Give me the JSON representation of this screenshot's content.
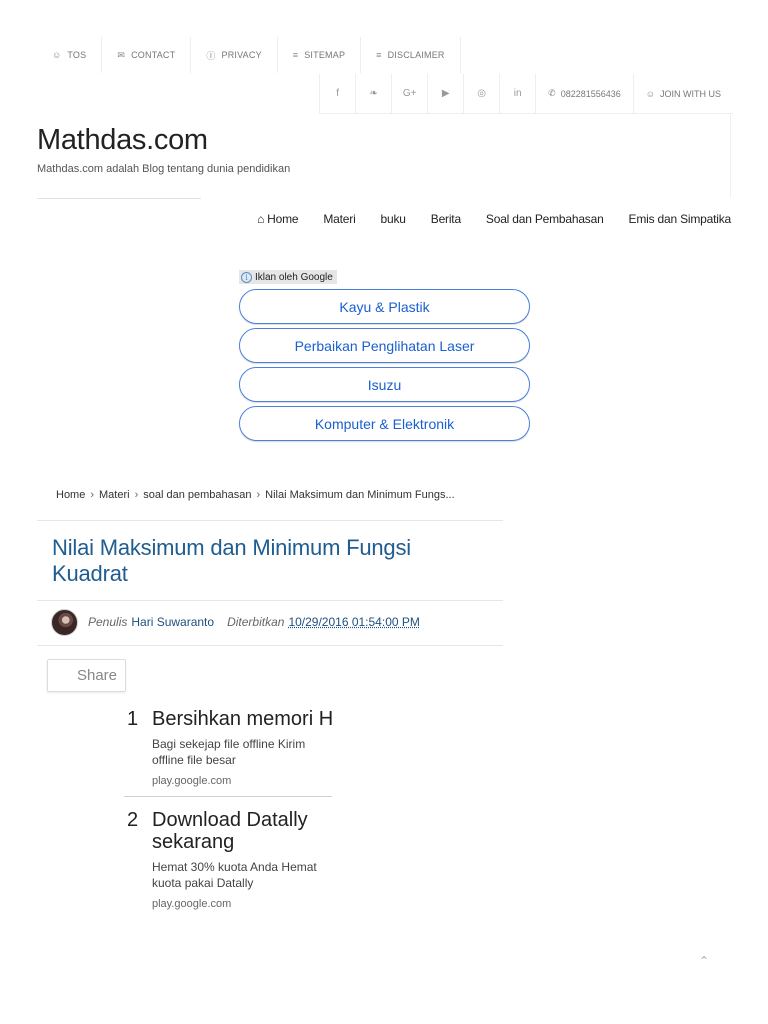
{
  "top_menu": [
    {
      "icon": "user-icon",
      "glyph": "☺",
      "label": "TOS"
    },
    {
      "icon": "envelope-icon",
      "glyph": "✉",
      "label": "CONTACT"
    },
    {
      "icon": "info-icon",
      "glyph": "ⓘ",
      "label": "PRIVACY"
    },
    {
      "icon": "list-icon",
      "glyph": "≡",
      "label": "SITEMAP"
    },
    {
      "icon": "list-icon",
      "glyph": "≡",
      "label": "DISCLAIMER"
    }
  ],
  "social": {
    "icons": [
      {
        "name": "facebook-icon",
        "glyph": "f"
      },
      {
        "name": "twitter-icon",
        "glyph": "❧"
      },
      {
        "name": "google-plus-icon",
        "glyph": "G+"
      },
      {
        "name": "youtube-icon",
        "glyph": "▶"
      },
      {
        "name": "instagram-icon",
        "glyph": "◎"
      },
      {
        "name": "linkedin-icon",
        "glyph": "in"
      }
    ],
    "phone": "082281556436",
    "join": "JOIN WITH US"
  },
  "header": {
    "site_title": "Mathdas.com",
    "site_description": "Mathdas.com adalah Blog tentang dunia pendidikan"
  },
  "nav": {
    "items": [
      "Home",
      "Materi",
      "buku",
      "Berita",
      "Soal dan Pembahasan",
      "Emis dan Simpatika"
    ]
  },
  "ad_block": {
    "label": "Iklan oleh Google",
    "links": [
      "Kayu & Plastik",
      "Perbaikan Penglihatan Laser",
      "Isuzu",
      "Komputer & Elektronik"
    ]
  },
  "breadcrumb": [
    "Home",
    "Materi",
    "soal dan pembahasan",
    "Nilai Maksimum dan Minimum Fungs..."
  ],
  "post": {
    "title": "Nilai Maksimum dan Minimum Fungsi Kuadrat",
    "author_label": "Penulis",
    "author": "Hari Suwaranto",
    "published_label": "Diterbitkan",
    "published": "10/29/2016 01:54:00 PM"
  },
  "share_label": "Share",
  "ad_list": [
    {
      "num": "1",
      "title": "Bersihkan memori HP",
      "desc_line1": "Bagi sekejap file offline Kirim",
      "desc_line2": "offline file besar",
      "url": "play.google.com"
    },
    {
      "num": "2",
      "title": "Download Datally sekarang",
      "desc_line1": "Hemat 30% kuota Anda Hemat",
      "desc_line2": "kuota pakai Datally",
      "url": "play.google.com"
    }
  ],
  "colors": {
    "title_blue": "#1f5c8f",
    "ad_border": "#4a80e0",
    "ad_text": "#1a5fd0"
  }
}
